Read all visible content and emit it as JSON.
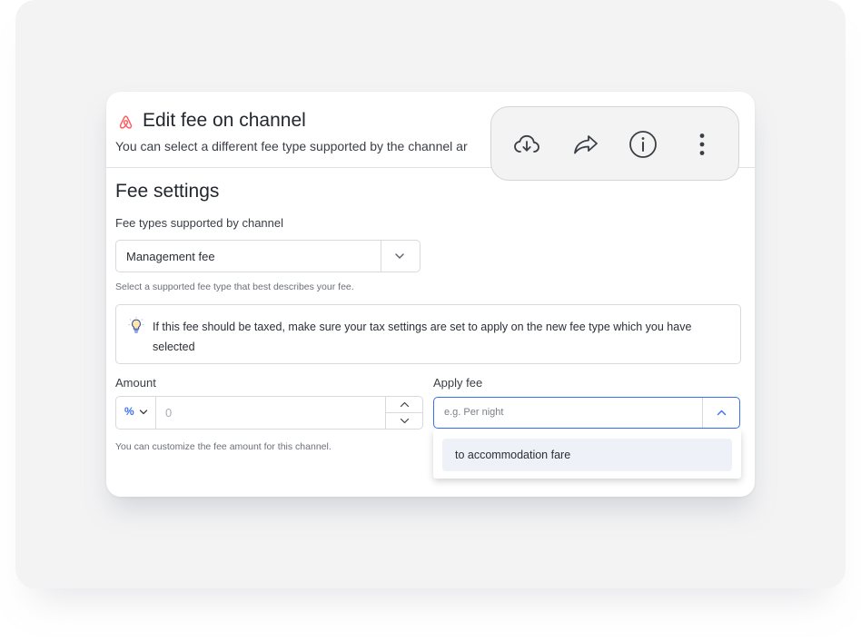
{
  "dialog": {
    "title": "Edit fee on channel",
    "subtitle": "You can select a different fee type supported by the channel ar",
    "channel_icon": "airbnb-icon"
  },
  "fee_settings": {
    "section_title": "Fee settings",
    "fee_type_label": "Fee types supported by channel",
    "fee_type_value": "Management fee",
    "fee_type_hint": "Select a supported fee type that best describes your fee.",
    "info_text": "If this fee should be taxed, make sure your tax settings are set to apply on the new fee type which you have selected",
    "info_icon": "lightbulb-icon",
    "amount_label": "Amount",
    "amount_unit": "%",
    "amount_placeholder": "0",
    "amount_hint": "You can customize the fee amount for this channel.",
    "apply_label": "Apply fee",
    "apply_placeholder": "e.g. Per night",
    "apply_options": [
      "to accommodation fare"
    ]
  },
  "toolbar": {
    "icons": [
      "cloud-download-icon",
      "share-icon",
      "info-icon",
      "more-vertical-icon"
    ]
  },
  "colors": {
    "accent": "#3b6ff2",
    "airbnb": "#ff5a5f",
    "background": "#f3f3f4"
  }
}
